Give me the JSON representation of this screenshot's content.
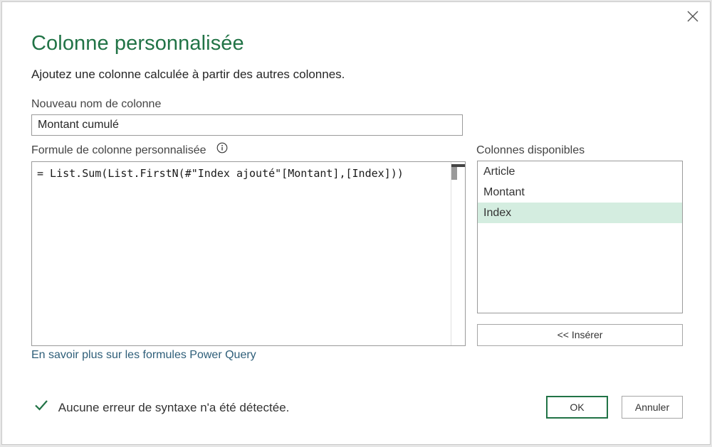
{
  "dialog": {
    "title": "Colonne personnalisée",
    "subtitle": "Ajoutez une colonne calculée à partir des autres colonnes.",
    "close_icon": "close-icon"
  },
  "name_field": {
    "label": "Nouveau nom de colonne",
    "value": "Montant cumulé"
  },
  "formula": {
    "label": "Formule de colonne personnalisée",
    "info_icon": "info-icon",
    "text": "= List.Sum(List.FirstN(#\"Index ajouté\"[Montant],[Index]))"
  },
  "available_columns": {
    "label": "Colonnes disponibles",
    "items": [
      {
        "label": "Article",
        "selected": false
      },
      {
        "label": "Montant",
        "selected": false
      },
      {
        "label": "Index",
        "selected": true
      }
    ],
    "insert_label": "<< Insérer"
  },
  "learn_more_link": "En savoir plus sur les formules Power Query",
  "status": {
    "icon": "checkmark-icon",
    "text": "Aucune erreur de syntaxe n'a été détectée."
  },
  "buttons": {
    "ok": "OK",
    "cancel": "Annuler"
  },
  "colors": {
    "accent": "#217346",
    "selection": "#d4ede0",
    "link": "#2e5e79"
  }
}
